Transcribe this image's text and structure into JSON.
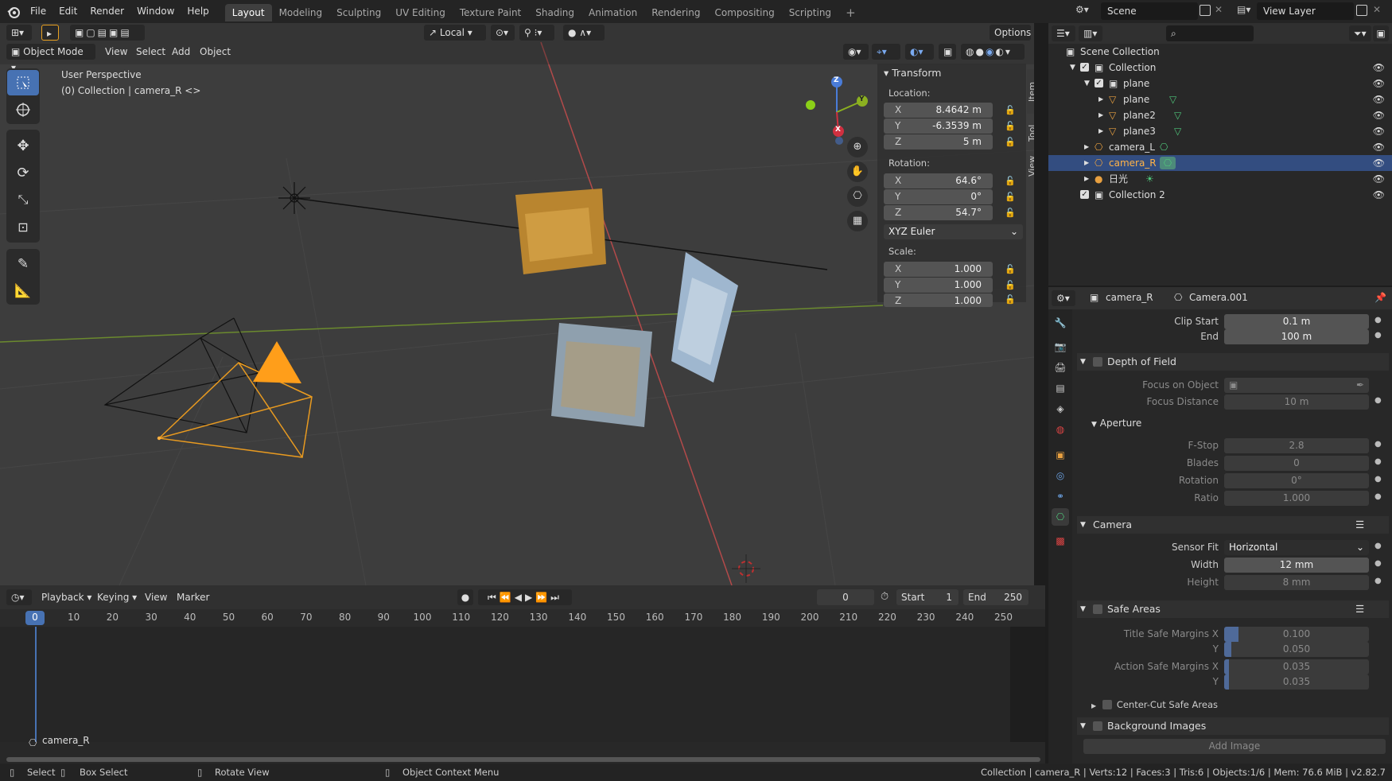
{
  "menu": {
    "file": "File",
    "edit": "Edit",
    "render": "Render",
    "window": "Window",
    "help": "Help"
  },
  "workspaces": [
    "Layout",
    "Modeling",
    "Sculpting",
    "UV Editing",
    "Texture Paint",
    "Shading",
    "Animation",
    "Rendering",
    "Compositing",
    "Scripting"
  ],
  "topright": {
    "scene": "Scene",
    "view_layer": "View Layer"
  },
  "viewport": {
    "orientation": "Local",
    "options": "Options",
    "mode": "Object Mode",
    "menus": [
      "View",
      "Select",
      "Add",
      "Object"
    ],
    "overlay_title": "User Perspective",
    "overlay_sub": "(0) Collection | camera_R <>",
    "gizmo": {
      "x": "X",
      "y": "Y",
      "z": "Z"
    }
  },
  "npanel": {
    "title": "Transform",
    "location": "Location:",
    "rotation": "Rotation:",
    "scale": "Scale:",
    "loc": [
      {
        "ax": "X",
        "v": "8.4642 m"
      },
      {
        "ax": "Y",
        "v": "-6.3539 m"
      },
      {
        "ax": "Z",
        "v": "5 m"
      }
    ],
    "rot": [
      {
        "ax": "X",
        "v": "64.6°"
      },
      {
        "ax": "Y",
        "v": "0°"
      },
      {
        "ax": "Z",
        "v": "54.7°"
      }
    ],
    "mode": "XYZ Euler",
    "scl": [
      {
        "ax": "X",
        "v": "1.000"
      },
      {
        "ax": "Y",
        "v": "1.000"
      },
      {
        "ax": "Z",
        "v": "1.000"
      }
    ],
    "tabs": [
      "Item",
      "Tool",
      "View"
    ]
  },
  "timeline": {
    "menus": [
      "Playback",
      "Keying",
      "View",
      "Marker"
    ],
    "current": "0",
    "start_label": "Start",
    "start": "1",
    "end_label": "End",
    "end": "250",
    "ticks": [
      "0",
      "10",
      "20",
      "30",
      "40",
      "50",
      "60",
      "70",
      "80",
      "90",
      "100",
      "110",
      "120",
      "130",
      "140",
      "150",
      "160",
      "170",
      "180",
      "190",
      "200",
      "210",
      "220",
      "230",
      "240",
      "250"
    ],
    "track": "camera_R"
  },
  "status": {
    "select": "Select",
    "box_select": "Box Select",
    "rotate": "Rotate View",
    "context": "Object Context Menu",
    "info": "Collection | camera_R | Verts:12 | Faces:3 | Tris:6 | Objects:1/6 | Mem: 76.6 MiB | v2.82.7"
  },
  "outliner": {
    "rows": [
      {
        "label": "Scene Collection"
      },
      {
        "label": "Collection"
      },
      {
        "label": "plane"
      },
      {
        "label": "plane"
      },
      {
        "label": "plane2"
      },
      {
        "label": "plane3"
      },
      {
        "label": "camera_L"
      },
      {
        "label": "camera_R"
      },
      {
        "label": "日光"
      },
      {
        "label": "Collection 2"
      }
    ]
  },
  "props": {
    "object": "camera_R",
    "data": "Camera.001",
    "clip_start_label": "Clip Start",
    "clip_start": "0.1 m",
    "clip_end_label": "End",
    "clip_end": "100 m",
    "dof": "Depth of Field",
    "focus_obj": "Focus on Object",
    "focus_dist": "Focus Distance",
    "focus_dist_v": "10 m",
    "aperture": "Aperture",
    "fstop": "F-Stop",
    "fstop_v": "2.8",
    "blades": "Blades",
    "blades_v": "0",
    "rotation": "Rotation",
    "rotation_v": "0°",
    "ratio": "Ratio",
    "ratio_v": "1.000",
    "camera": "Camera",
    "sensor_fit": "Sensor Fit",
    "sensor_fit_v": "Horizontal",
    "width": "Width",
    "width_v": "12 mm",
    "height": "Height",
    "height_v": "8 mm",
    "safe": "Safe Areas",
    "title_safe": "Title Safe Margins X",
    "title_safe_x": "0.100",
    "y": "Y",
    "title_safe_y": "0.050",
    "action_safe": "Action Safe Margins X",
    "action_safe_x": "0.035",
    "action_safe_y": "0.035",
    "center_cut": "Center-Cut Safe Areas",
    "bg": "Background Images",
    "add_image": "Add Image"
  }
}
